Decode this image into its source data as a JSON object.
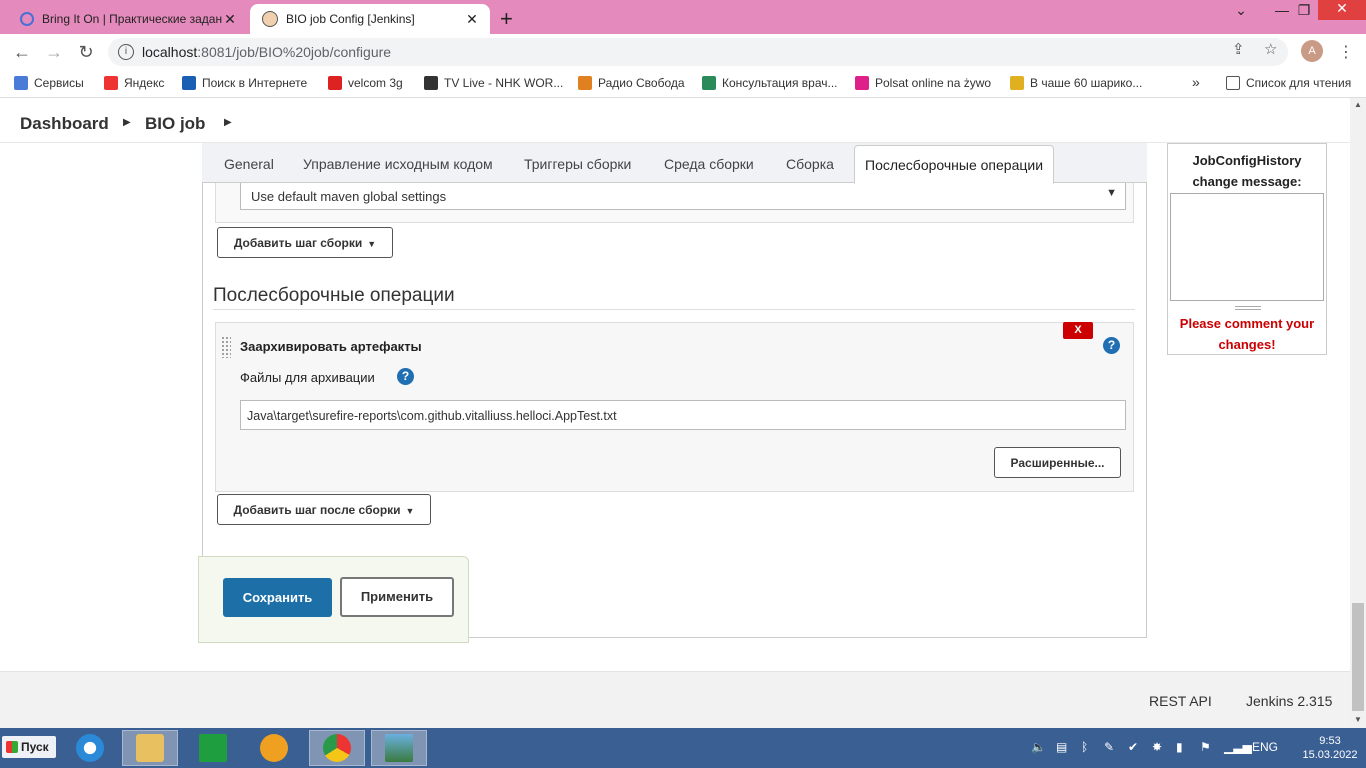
{
  "browser": {
    "tabs": [
      {
        "title": "Bring It On | Практические задания",
        "close": "✕"
      },
      {
        "title": "BIO job Config [Jenkins]",
        "close": "✕"
      }
    ],
    "new_tab": "+",
    "window_controls": {
      "down": "⌄",
      "minimize": "—",
      "restore": "❐",
      "close": "✕"
    },
    "url_host": "localhost",
    "url_path": ":8081/job/BIO%20job/configure",
    "avatar_letter": "A"
  },
  "bookmarks": [
    {
      "label": "Сервисы",
      "color": "#4a7bd6"
    },
    {
      "label": "Яндекс",
      "color": "#e33"
    },
    {
      "label": "Поиск в Интернете",
      "color": "#1a5fb4"
    },
    {
      "label": "velcom 3g",
      "color": "#d22"
    },
    {
      "label": "TV Live - NHK WOR...",
      "color": "#333"
    },
    {
      "label": "Радио Свобода",
      "color": "#e08020"
    },
    {
      "label": "Консультация врач...",
      "color": "#2a8a5a"
    },
    {
      "label": "Polsat online na żywo",
      "color": "#e0208a"
    },
    {
      "label": "В чаше 60 шарико...",
      "color": "#e0b020"
    }
  ],
  "bookmarks_more": "»",
  "reading_list": "Список для чтения",
  "breadcrumb": {
    "dashboard": "Dashboard",
    "job": "BIO job"
  },
  "config_tabs": [
    "General",
    "Управление исходным кодом",
    "Триггеры сборки",
    "Среда сборки",
    "Сборка",
    "Послесборочные операции"
  ],
  "maven_settings_value": "Use default maven global settings",
  "add_build_step": "Добавить шаг сборки",
  "post_build_title": "Послесборочные операции",
  "archive": {
    "title": "Заархивировать артефакты",
    "delete_label": "X",
    "files_label": "Файлы для архивации",
    "files_value": "Java\\target\\surefire-reports\\com.github.vitalliuss.helloci.AppTest.txt",
    "advanced": "Расширенные..."
  },
  "add_post_build_step": "Добавить шаг после сборки",
  "save": "Сохранить",
  "apply": "Применить",
  "job_config_history": {
    "title_line1": "JobConfigHistory",
    "title_line2": "change message:",
    "warning_line1": "Please comment your",
    "warning_line2": "changes!"
  },
  "footer": {
    "rest_api": "REST API",
    "version": "Jenkins 2.315"
  },
  "taskbar": {
    "start": "Пуск",
    "lang": "ENG",
    "time": "9:53",
    "date": "15.03.2022"
  },
  "help_glyph": "?",
  "colors": {
    "accent": "#1d6fa8",
    "danger": "#cc0000",
    "tab_strip": "#e58abc",
    "taskbar": "#3a5f93"
  }
}
